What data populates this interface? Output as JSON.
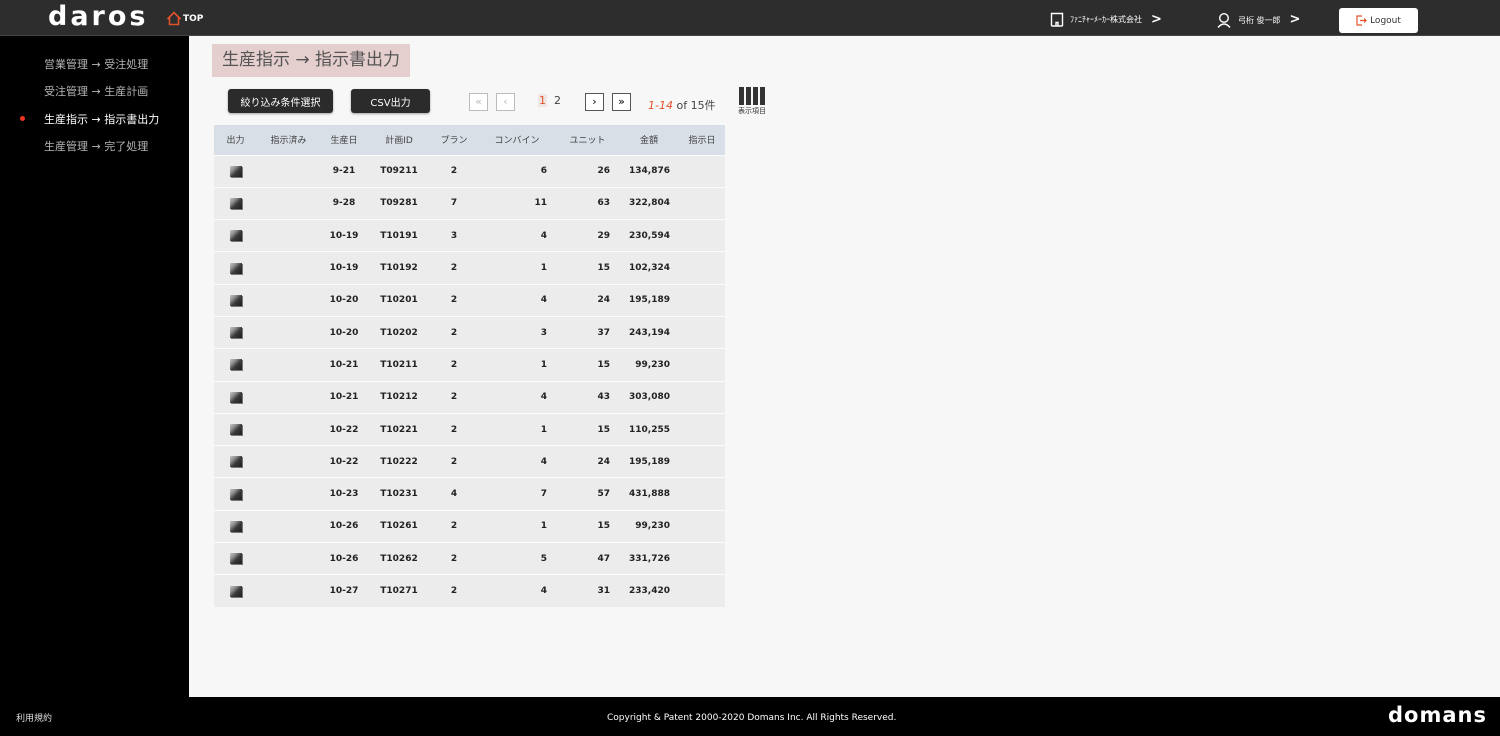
{
  "header": {
    "logo": "daros",
    "home_label": "TOP",
    "company": "ﾌｧﾆﾁｬｰﾒｰｶｰ株式会社",
    "user": "弓桁 俊一郎",
    "logout_label": "Logout",
    "accent_color": "#e0522c"
  },
  "sidebar": {
    "items": [
      {
        "label": "営業管理 → 受注処理"
      },
      {
        "label": "受注管理 → 生産計画"
      },
      {
        "label": "生産指示 → 指示書出力"
      },
      {
        "label": "生産管理 → 完了処理"
      }
    ],
    "active_index": 2
  },
  "main": {
    "title": "生産指示 → 指示書出力",
    "filter_label": "絞り込み条件選択",
    "csv_label": "CSV出力",
    "pagination": {
      "first": "«",
      "prev": "‹",
      "next": "›",
      "last": "»",
      "pages": [
        "1",
        "2"
      ],
      "current_page": "1",
      "range": "1-14",
      "of": "of",
      "total": "15件"
    },
    "columns_label": "表示項目"
  },
  "table": {
    "headers": [
      "出力",
      "指示済み",
      "生産日",
      "計画ID",
      "プラン",
      "コンバイン",
      "ユニット",
      "金額",
      "指示日"
    ],
    "rows": [
      [
        "9-21",
        "T09211",
        "2",
        "6",
        "26",
        "134,876"
      ],
      [
        "9-28",
        "T09281",
        "7",
        "11",
        "63",
        "322,804"
      ],
      [
        "10-19",
        "T10191",
        "3",
        "4",
        "29",
        "230,594"
      ],
      [
        "10-19",
        "T10192",
        "2",
        "1",
        "15",
        "102,324"
      ],
      [
        "10-20",
        "T10201",
        "2",
        "4",
        "24",
        "195,189"
      ],
      [
        "10-20",
        "T10202",
        "2",
        "3",
        "37",
        "243,194"
      ],
      [
        "10-21",
        "T10211",
        "2",
        "1",
        "15",
        "99,230"
      ],
      [
        "10-21",
        "T10212",
        "2",
        "4",
        "43",
        "303,080"
      ],
      [
        "10-22",
        "T10221",
        "2",
        "1",
        "15",
        "110,255"
      ],
      [
        "10-22",
        "T10222",
        "2",
        "4",
        "24",
        "195,189"
      ],
      [
        "10-23",
        "T10231",
        "4",
        "7",
        "57",
        "431,888"
      ],
      [
        "10-26",
        "T10261",
        "2",
        "1",
        "15",
        "99,230"
      ],
      [
        "10-26",
        "T10262",
        "2",
        "5",
        "47",
        "331,726"
      ],
      [
        "10-27",
        "T10271",
        "2",
        "4",
        "31",
        "233,420"
      ]
    ]
  },
  "footer": {
    "terms": "利用規約",
    "copyright": "Copyright & Patent 2000-2020 Domans Inc. All Rights Reserved.",
    "logo": "domans"
  }
}
